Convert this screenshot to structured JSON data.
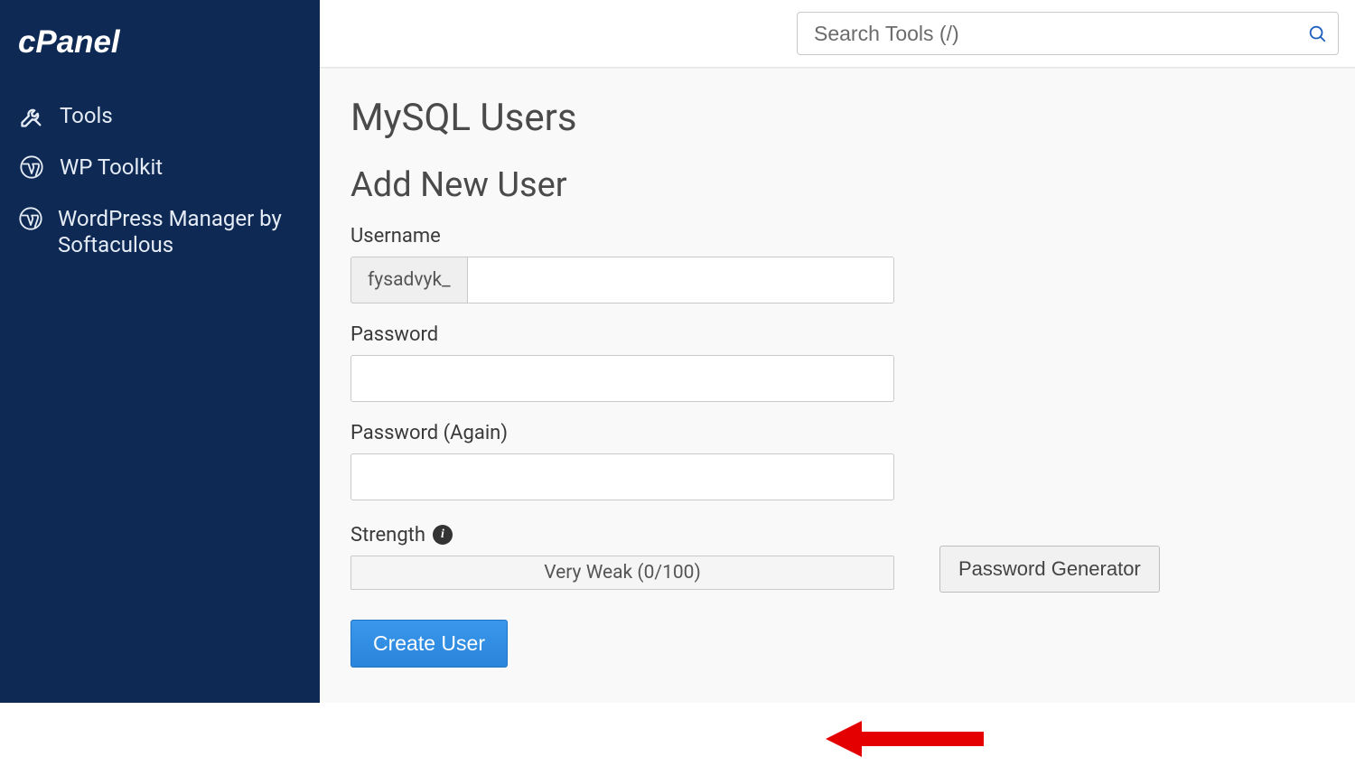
{
  "brand": "cPanel",
  "sidebar": {
    "items": [
      {
        "label": "Tools",
        "icon": "tools"
      },
      {
        "label": "WP Toolkit",
        "icon": "wordpress"
      },
      {
        "label": "WordPress Manager by Softaculous",
        "icon": "wordpress"
      }
    ]
  },
  "search": {
    "placeholder": "Search Tools (/)"
  },
  "page": {
    "title": "MySQL Users",
    "section_title": "Add New User",
    "username_label": "Username",
    "username_prefix": "fysadvyk_",
    "password_label": "Password",
    "password_again_label": "Password (Again)",
    "strength_label": "Strength",
    "strength_value": "Very Weak (0/100)",
    "password_generator_label": "Password Generator",
    "create_user_label": "Create User"
  }
}
